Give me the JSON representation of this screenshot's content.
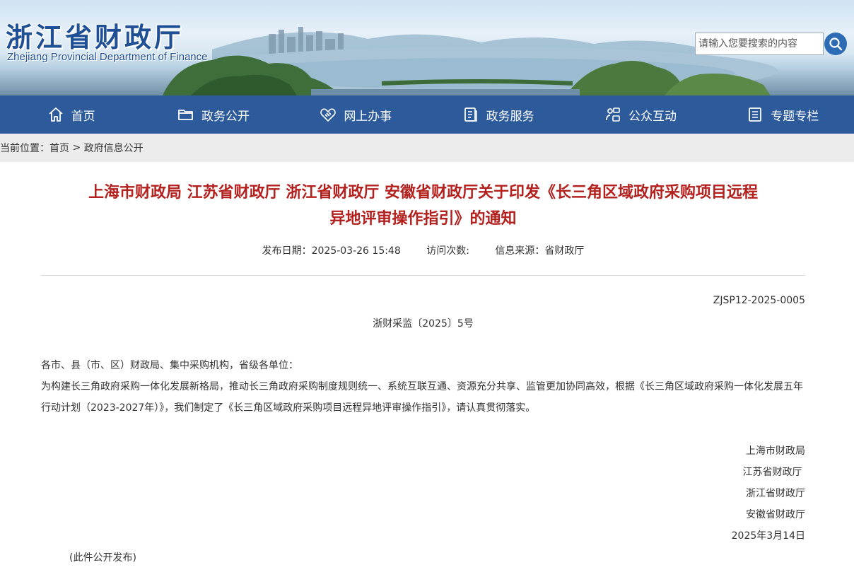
{
  "header": {
    "logo_cn": "浙江省财政厅",
    "logo_en": "Zhejiang Provincial Department of Finance",
    "search_placeholder": "请输入您要搜索的内容"
  },
  "nav": {
    "items": [
      {
        "label": "首页",
        "icon": "home-icon"
      },
      {
        "label": "政务公开",
        "icon": "folder-icon"
      },
      {
        "label": "网上办事",
        "icon": "handshake-icon"
      },
      {
        "label": "政务服务",
        "icon": "document-icon"
      },
      {
        "label": "公众互动",
        "icon": "interaction-icon"
      },
      {
        "label": "专题专栏",
        "icon": "list-icon"
      }
    ]
  },
  "breadcrumb": {
    "prefix": "当前位置：",
    "home": "首页",
    "separator": " > ",
    "current": "政府信息公开"
  },
  "article": {
    "title_line1": "上海市财政局 江苏省财政厅 浙江省财政厅 安徽省财政厅关于印发《长三角区域政府采购项目远程",
    "title_line2": "异地评审操作指引》的通知",
    "publish_label": "发布日期：",
    "publish_date": "2025-03-26 15:48",
    "visits_label": "访问次数:",
    "source_label": "信息来源：",
    "source": "省财政厅",
    "doc_code": "ZJSP12-2025-0005",
    "doc_number": "浙财采监〔2025〕5号",
    "salutation": "各市、县（市、区）财政局、集中采购机构，省级各单位：",
    "body": "为构建长三角政府采购一体化发展新格局，推动长三角政府采购制度规则统一、系统互联互通、资源充分共享、监管更加协同高效，根据《长三角区域政府采购一体化发展五年行动计划（2023-2027年）》，我们制定了《长三角区域政府采购项目远程异地评审操作指引》，请认真贯彻落实。",
    "signers": [
      "上海市财政局",
      "江苏省财政厅 ",
      "浙江省财政厅",
      "安徽省财政厅"
    ],
    "date": "2025年3月14日",
    "footnote": "(此件公开发布)"
  },
  "colors": {
    "nav_bg": "#2c5a9a",
    "title_red": "#b3201e",
    "logo_blue": "#1f4f94",
    "crumb_bg": "#ececec"
  }
}
